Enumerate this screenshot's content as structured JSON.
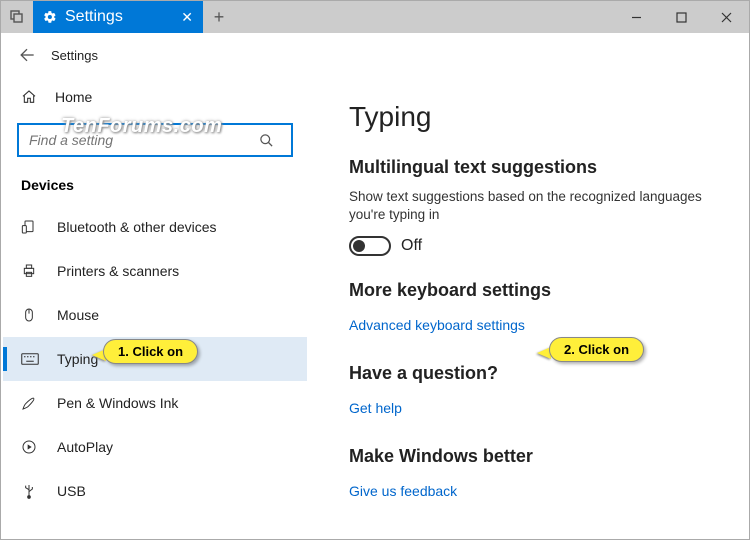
{
  "tabstrip": {
    "tab_title": "Settings",
    "newtab": "+"
  },
  "header": {
    "title": "Settings"
  },
  "sidebar": {
    "home": "Home",
    "search_placeholder": "Find a setting",
    "section": "Devices",
    "items": [
      {
        "label": "Bluetooth & other devices"
      },
      {
        "label": "Printers & scanners"
      },
      {
        "label": "Mouse"
      },
      {
        "label": "Typing"
      },
      {
        "label": "Pen & Windows Ink"
      },
      {
        "label": "AutoPlay"
      },
      {
        "label": "USB"
      }
    ],
    "selected_index": 3
  },
  "main": {
    "title": "Typing",
    "section1": {
      "heading": "Multilingual text suggestions",
      "desc": "Show text suggestions based on the recognized languages you're typing in",
      "toggle_label": "Off"
    },
    "section2": {
      "heading": "More keyboard settings",
      "link": "Advanced keyboard settings"
    },
    "section3": {
      "heading": "Have a question?",
      "link": "Get help"
    },
    "section4": {
      "heading": "Make Windows better",
      "link": "Give us feedback"
    }
  },
  "annotations": {
    "callout1": "1. Click on",
    "callout2": "2. Click on",
    "watermark": "TenForums.com"
  }
}
